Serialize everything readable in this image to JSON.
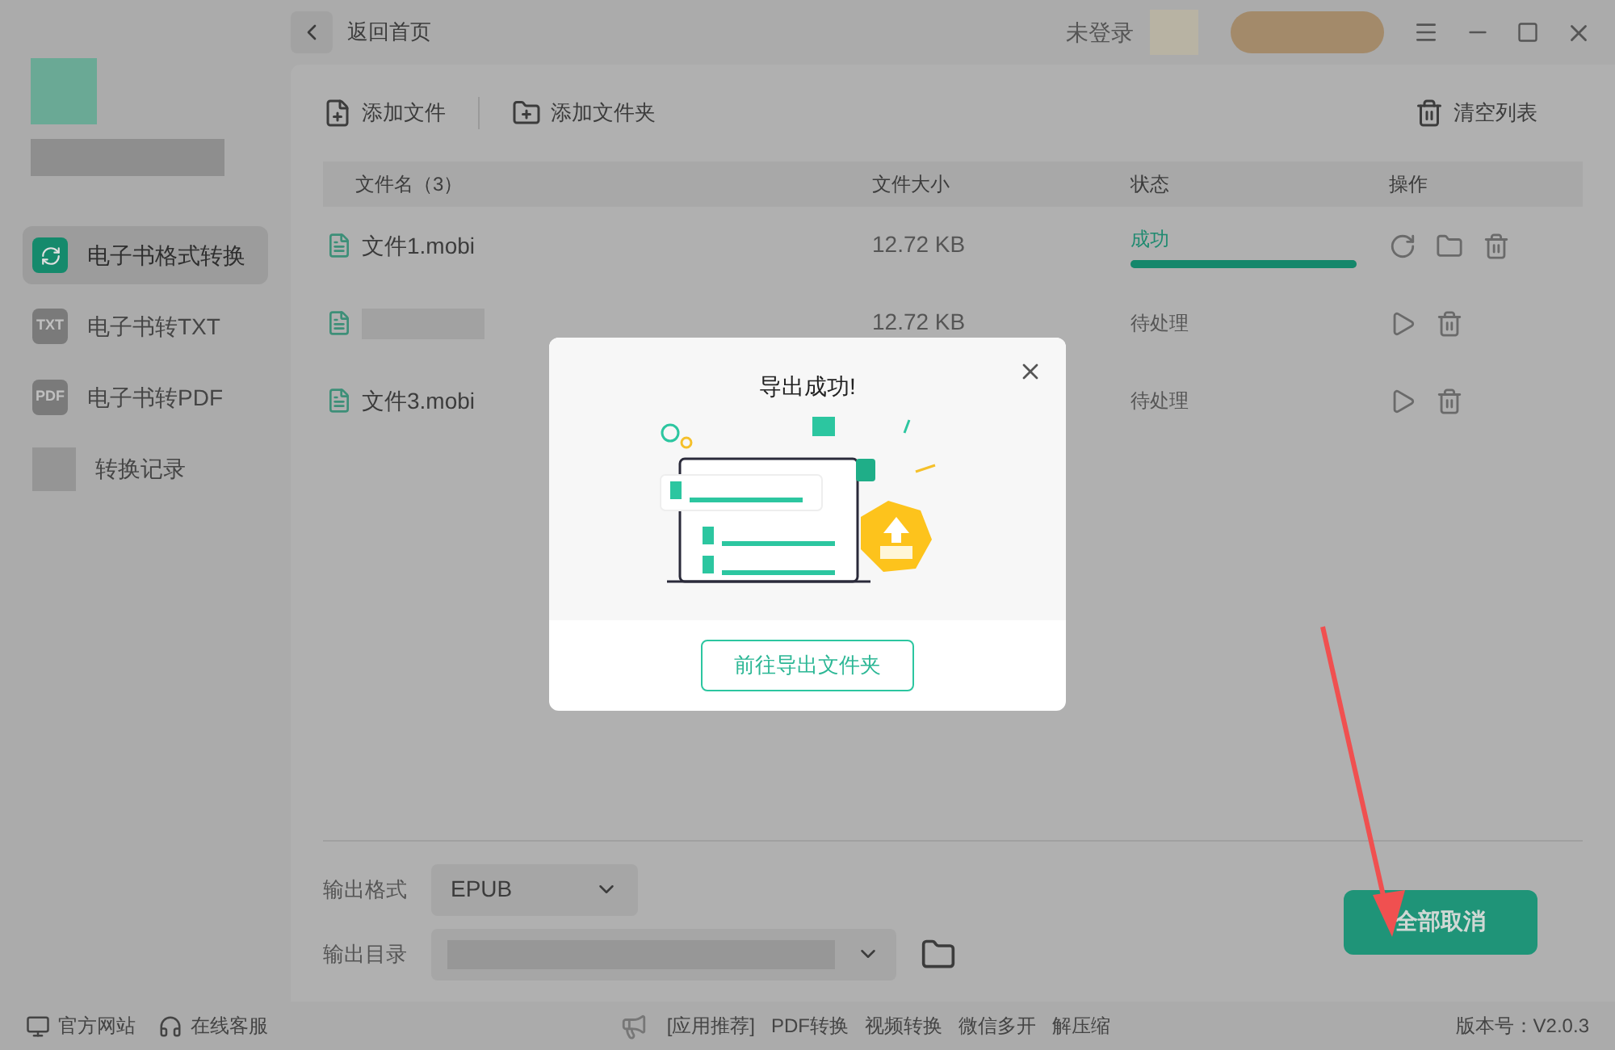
{
  "window": {
    "back_label": "返回首页",
    "login": "未登录"
  },
  "sidebar": {
    "items": [
      {
        "label": "电子书格式转换",
        "kind": "convert",
        "selected": true
      },
      {
        "label": "电子书转TXT",
        "kind": "badge",
        "icon_text": "TXT",
        "selected": false
      },
      {
        "label": "电子书转PDF",
        "kind": "badge",
        "icon_text": "PDF",
        "selected": false
      },
      {
        "label": "转换记录",
        "kind": "plain",
        "selected": false
      }
    ]
  },
  "toolbar": {
    "buttons": [
      {
        "label": "添加文件",
        "kind": "file"
      },
      {
        "label": "添加文件夹",
        "kind": "folder"
      }
    ],
    "clear": "清空列表"
  },
  "table": {
    "columns": [
      "文件名（3）",
      "文件大小",
      "状态",
      "操作"
    ],
    "rows": [
      {
        "name": "文件1.mobi",
        "size": "12.72 KB",
        "status": "成功",
        "kind": "done",
        "level": 1
      },
      {
        "size": "12.72 KB",
        "status": "待处理",
        "kind": "pending"
      },
      {
        "name": "文件3.mobi",
        "status": "待处理",
        "kind": "pending"
      }
    ]
  },
  "modal": {
    "title": "导出成功!",
    "button": "前往导出文件夹"
  },
  "output": {
    "format_label": "输出格式",
    "format": "EPUB",
    "dir_label": "输出目录",
    "action": "全部取消"
  },
  "footer": {
    "links": [
      "官方网站",
      "在线客服"
    ],
    "promo": [
      "[应用推荐]",
      "PDF转换",
      "视频转换",
      "微信多开",
      "解压缩"
    ],
    "version": "版本号：V2.0.3"
  }
}
